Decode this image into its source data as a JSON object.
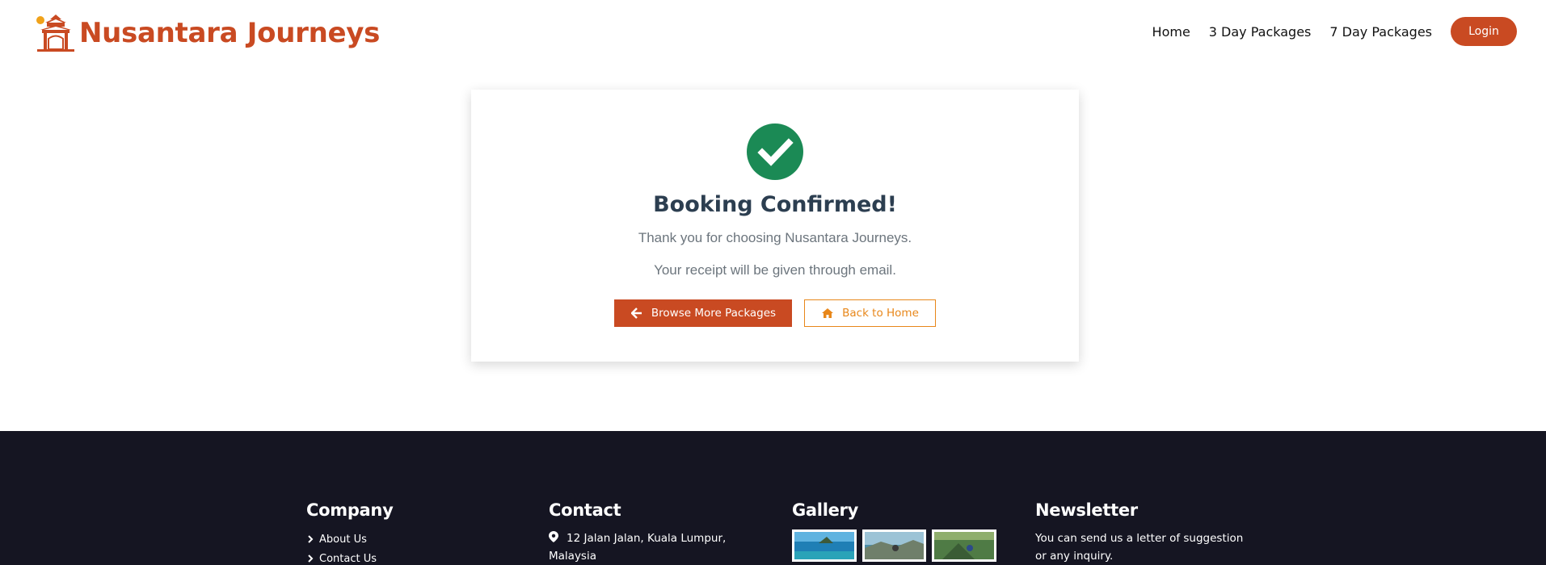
{
  "brand": {
    "name": "Nusantara Journeys",
    "logo_icon": "pagoda-gate-icon",
    "color": "#c94a22"
  },
  "nav": {
    "links": [
      "Home",
      "3 Day Packages",
      "7 Day Packages"
    ],
    "login_label": "Login"
  },
  "confirmation": {
    "icon": "check-circle-icon",
    "icon_color": "#1b8a55",
    "title": "Booking Confirmed!",
    "message": "Thank you for choosing Nusantara Journeys.",
    "receipt_note": "Your receipt will be given through email.",
    "primary_button": {
      "label": "Browse More Packages",
      "icon": "arrow-left-icon"
    },
    "secondary_button": {
      "label": "Back to Home",
      "icon": "home-icon"
    }
  },
  "footer": {
    "company": {
      "heading": "Company",
      "links": [
        "About Us",
        "Contact Us"
      ]
    },
    "contact": {
      "heading": "Contact",
      "address": "12 Jalan Jalan, Kuala Lumpur, Malaysia"
    },
    "gallery": {
      "heading": "Gallery",
      "thumbnails": [
        "gallery-thumb-1",
        "gallery-thumb-2",
        "gallery-thumb-3"
      ]
    },
    "newsletter": {
      "heading": "Newsletter",
      "text": "You can send us a letter of suggestion or any inquiry."
    }
  },
  "colors": {
    "accent": "#c94a22",
    "outline": "#e8871a",
    "footer_bg": "#151522",
    "title": "#2c3e50"
  }
}
